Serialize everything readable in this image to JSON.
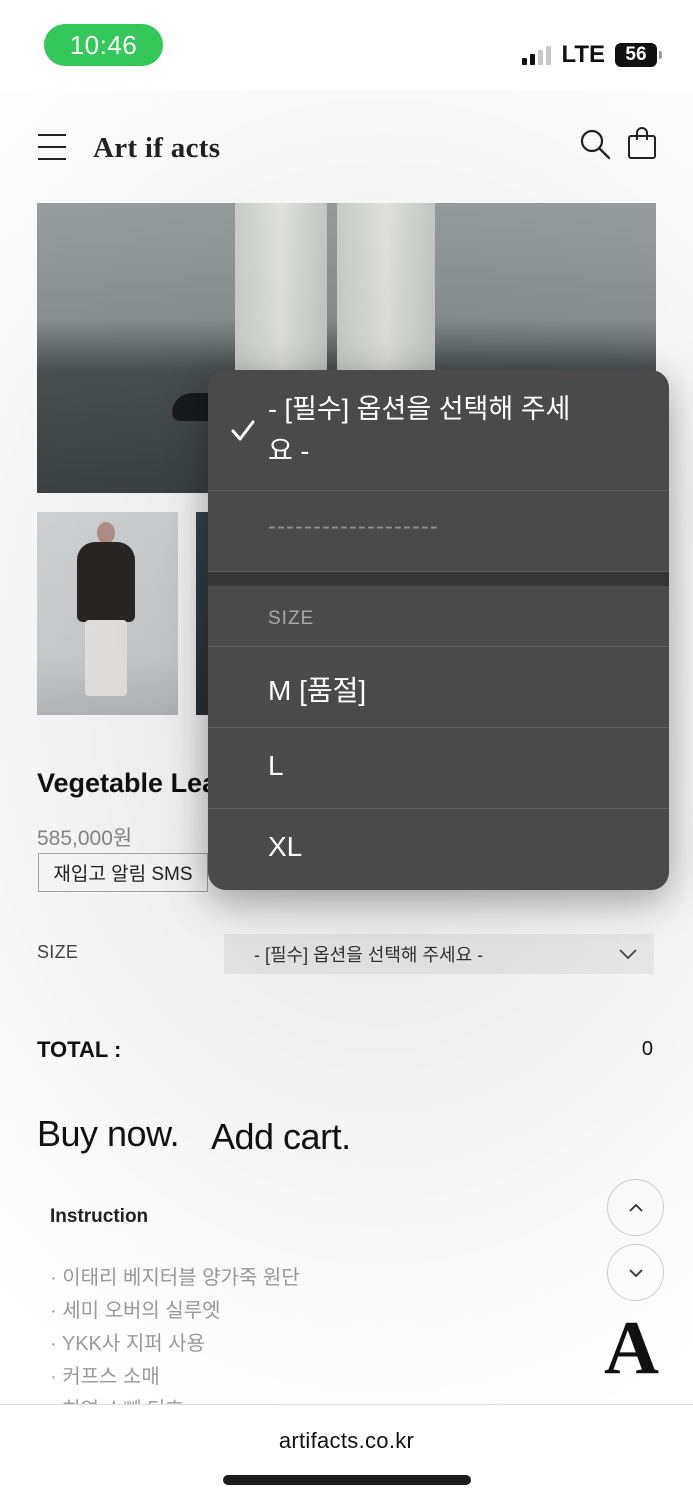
{
  "status_bar": {
    "time": "10:46",
    "network": "LTE",
    "battery": "56"
  },
  "header": {
    "brand": "Art if acts"
  },
  "product": {
    "name": "Vegetable Lea",
    "price": "585,000원",
    "restock_sms_label": "재입고 알림 SMS"
  },
  "options": {
    "size_label": "SIZE",
    "size_select_value": "- [필수] 옵션을 선택해 주세요 -"
  },
  "total": {
    "label": "TOTAL :",
    "value": "0"
  },
  "actions": {
    "buy_now": "Buy now.",
    "add_cart": "Add cart."
  },
  "instruction": {
    "title": "Instruction",
    "items": [
      "· 이태리 베지터블 양가죽 원단",
      "· 세미 오버의 실루엣",
      "· YKK사 지퍼 사용",
      "· 커프스 소매",
      "· 히연 스뻬 디흐"
    ]
  },
  "logo_mark": "A",
  "footer": {
    "domain": "artifacts.co.kr"
  },
  "picker": {
    "selected": "- [필수] 옵션을 선택해 주세요 -",
    "divider": "-------------------",
    "group_header": "SIZE",
    "options": [
      "M [품절]",
      "L",
      "XL"
    ]
  }
}
